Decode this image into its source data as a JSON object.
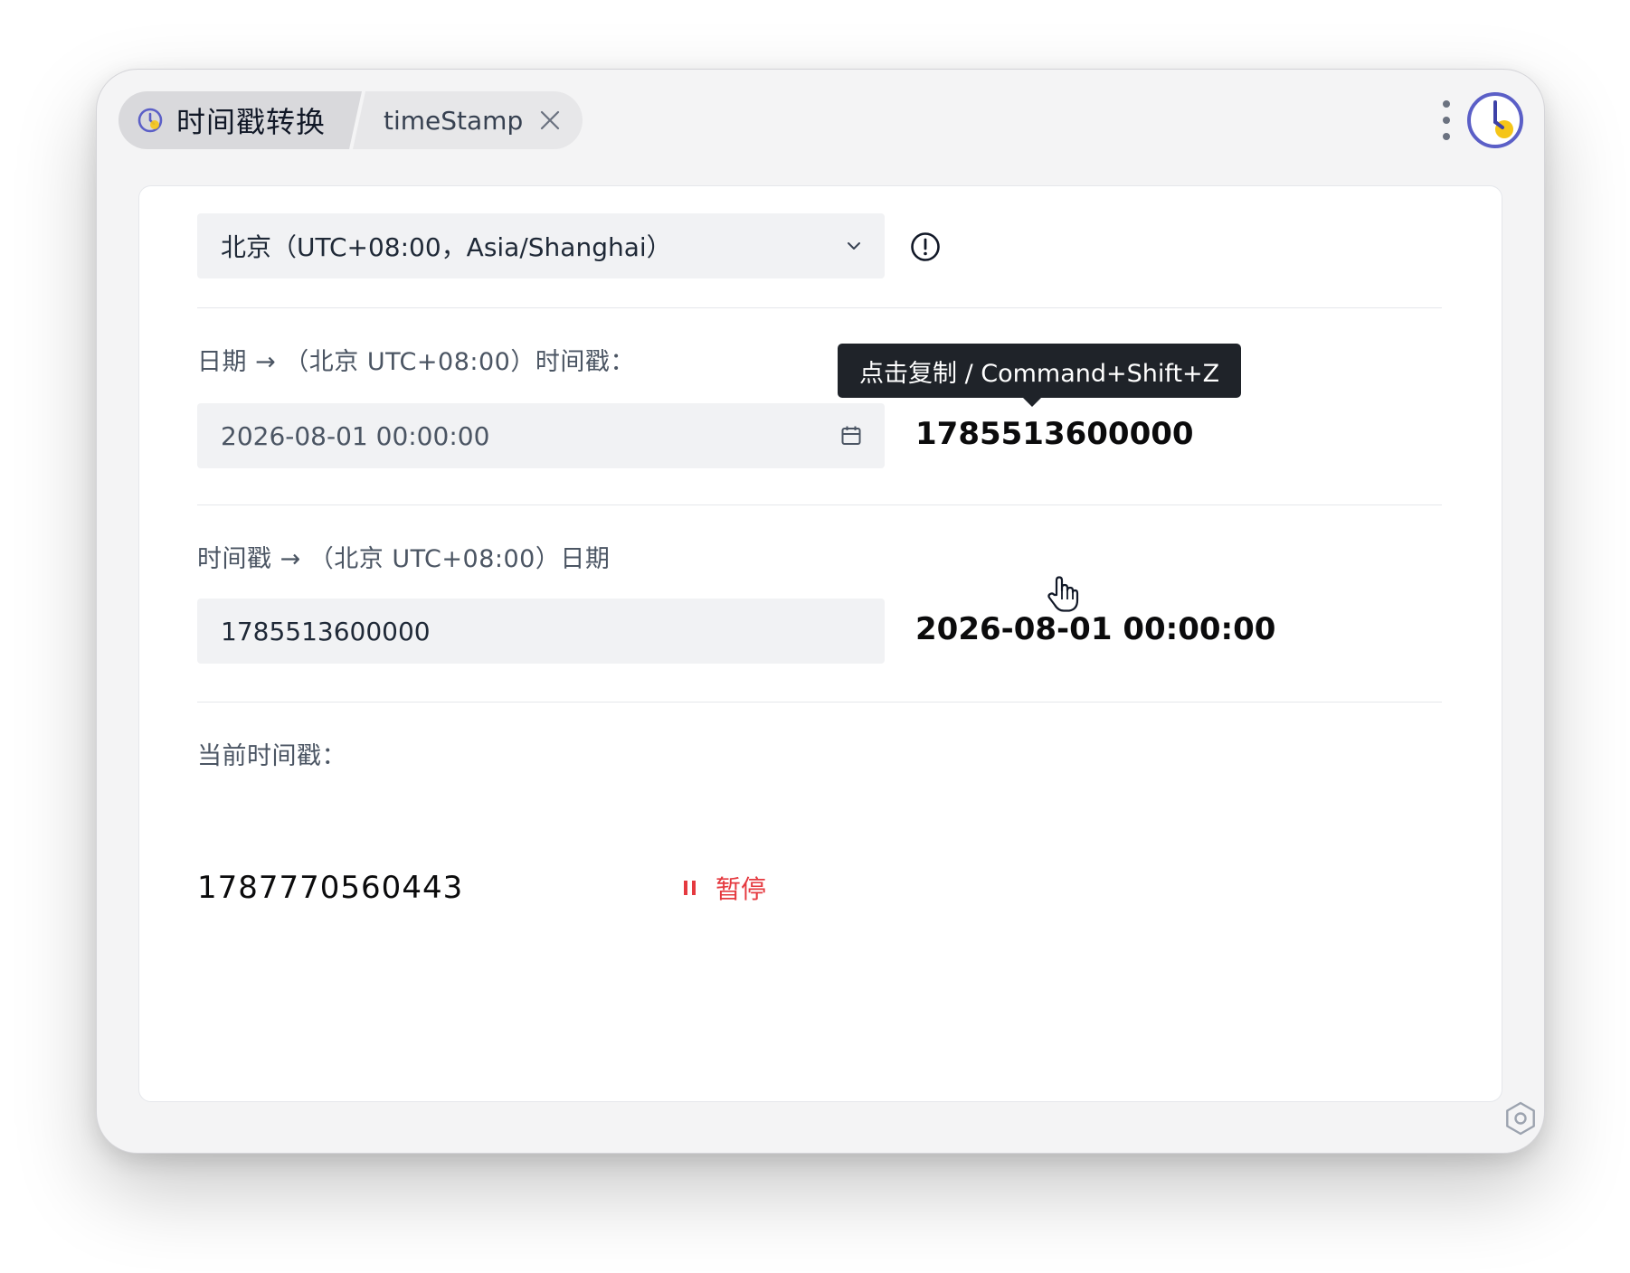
{
  "window": {
    "tab_title": "时间戳转换",
    "tab_sub_label": "timeStamp",
    "icons": {
      "tab": "clock-icon",
      "close": "close-icon",
      "more": "more-vertical-icon",
      "app": "clock-app-icon",
      "settings": "settings-icon"
    },
    "colors": {
      "accent": "#5b5fc7",
      "accent_yellow": "#f5c518"
    }
  },
  "timezone": {
    "selected": "北京（UTC+08:00，Asia/Shanghai）",
    "icon": "chevron-down-icon",
    "info_icon": "info-circle-icon"
  },
  "date_to_ts": {
    "label": "日期 → （北京 UTC+08:00）时间戳：",
    "input_value": "2026-08-01 00:00:00",
    "calendar_icon": "calendar-icon",
    "result": "1785513600000",
    "tooltip": "点击复制 / Command+Shift+Z"
  },
  "ts_to_date": {
    "label": "时间戳 → （北京 UTC+08:00）日期",
    "input_value": "1785513600000",
    "result": "2026-08-01 00:00:00"
  },
  "current": {
    "label": "当前时间戳：",
    "value": "1787770560443",
    "pause_label": "暂停",
    "pause_icon": "pause-icon",
    "pause_color": "#e5393f"
  }
}
